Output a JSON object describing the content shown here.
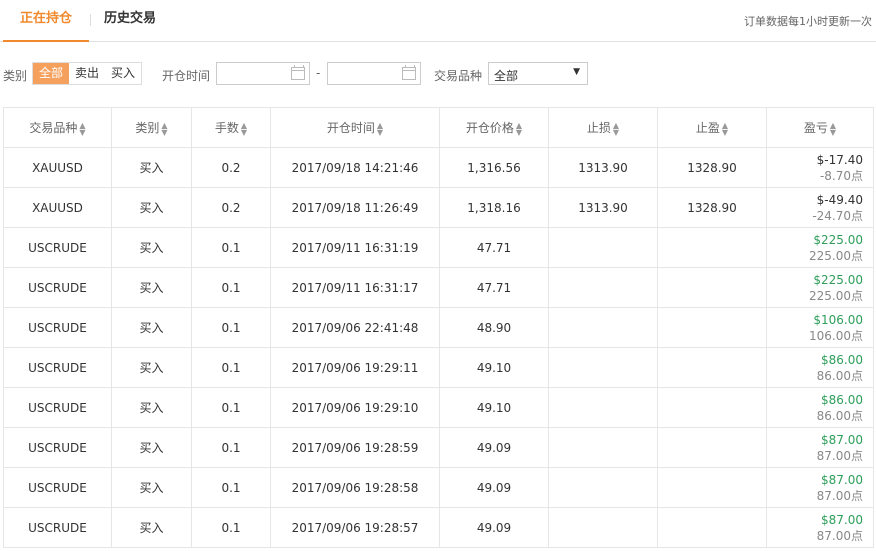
{
  "tabs": {
    "active": "正在持仓",
    "other": "历史交易"
  },
  "notice": "订单数据每1小时更新一次",
  "filters": {
    "type_label": "类别",
    "type_options": [
      "全部",
      "卖出",
      "买入"
    ],
    "open_time_label": "开仓时间",
    "date_from": "",
    "date_to": "",
    "dash": "-",
    "symbol_label": "交易品种",
    "symbol_value": "全部"
  },
  "colors": {
    "accent": "#f18a2e",
    "buy": "#2e9e5a"
  },
  "table": {
    "headers": [
      "交易品种",
      "类别",
      "手数",
      "开仓时间",
      "开仓价格",
      "止损",
      "止盈",
      "盈亏"
    ],
    "rows": [
      {
        "symbol": "XAUUSD",
        "type": "买入",
        "lots": "0.2",
        "open_time": "2017/09/18 14:21:46",
        "open_price": "1,316.56",
        "sl": "1313.90",
        "tp": "1328.90",
        "pl": "$-17.40",
        "pts": "-8.70点",
        "pl_sign": "neg"
      },
      {
        "symbol": "XAUUSD",
        "type": "买入",
        "lots": "0.2",
        "open_time": "2017/09/18 11:26:49",
        "open_price": "1,318.16",
        "sl": "1313.90",
        "tp": "1328.90",
        "pl": "$-49.40",
        "pts": "-24.70点",
        "pl_sign": "neg"
      },
      {
        "symbol": "USCRUDE",
        "type": "买入",
        "lots": "0.1",
        "open_time": "2017/09/11 16:31:19",
        "open_price": "47.71",
        "sl": "",
        "tp": "",
        "pl": "$225.00",
        "pts": "225.00点",
        "pl_sign": "pos"
      },
      {
        "symbol": "USCRUDE",
        "type": "买入",
        "lots": "0.1",
        "open_time": "2017/09/11 16:31:17",
        "open_price": "47.71",
        "sl": "",
        "tp": "",
        "pl": "$225.00",
        "pts": "225.00点",
        "pl_sign": "pos"
      },
      {
        "symbol": "USCRUDE",
        "type": "买入",
        "lots": "0.1",
        "open_time": "2017/09/06 22:41:48",
        "open_price": "48.90",
        "sl": "",
        "tp": "",
        "pl": "$106.00",
        "pts": "106.00点",
        "pl_sign": "pos"
      },
      {
        "symbol": "USCRUDE",
        "type": "买入",
        "lots": "0.1",
        "open_time": "2017/09/06 19:29:11",
        "open_price": "49.10",
        "sl": "",
        "tp": "",
        "pl": "$86.00",
        "pts": "86.00点",
        "pl_sign": "pos"
      },
      {
        "symbol": "USCRUDE",
        "type": "买入",
        "lots": "0.1",
        "open_time": "2017/09/06 19:29:10",
        "open_price": "49.10",
        "sl": "",
        "tp": "",
        "pl": "$86.00",
        "pts": "86.00点",
        "pl_sign": "pos"
      },
      {
        "symbol": "USCRUDE",
        "type": "买入",
        "lots": "0.1",
        "open_time": "2017/09/06 19:28:59",
        "open_price": "49.09",
        "sl": "",
        "tp": "",
        "pl": "$87.00",
        "pts": "87.00点",
        "pl_sign": "pos"
      },
      {
        "symbol": "USCRUDE",
        "type": "买入",
        "lots": "0.1",
        "open_time": "2017/09/06 19:28:58",
        "open_price": "49.09",
        "sl": "",
        "tp": "",
        "pl": "$87.00",
        "pts": "87.00点",
        "pl_sign": "pos"
      },
      {
        "symbol": "USCRUDE",
        "type": "买入",
        "lots": "0.1",
        "open_time": "2017/09/06 19:28:57",
        "open_price": "49.09",
        "sl": "",
        "tp": "",
        "pl": "$87.00",
        "pts": "87.00点",
        "pl_sign": "pos"
      }
    ]
  }
}
